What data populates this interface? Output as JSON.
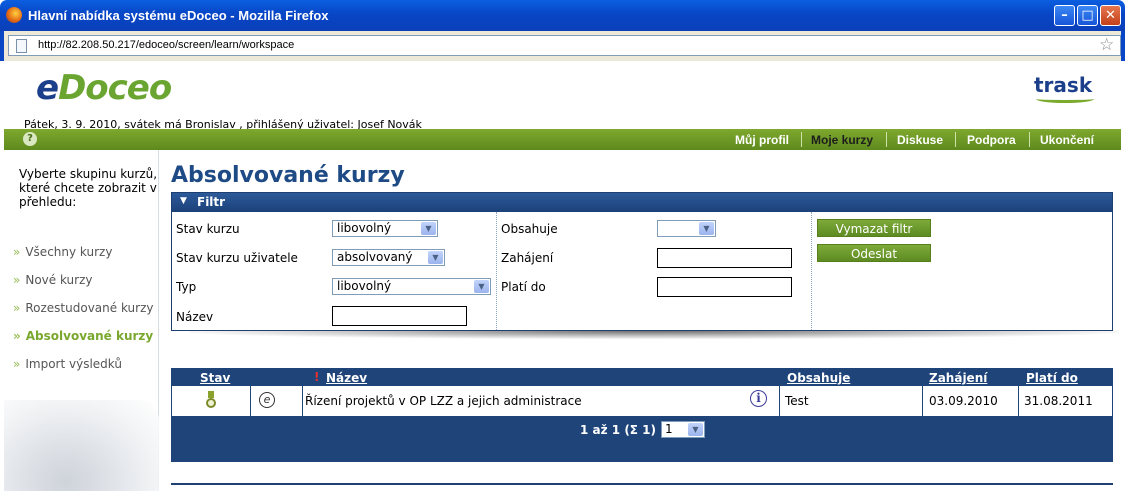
{
  "window": {
    "title": "Hlavní nabídka systému eDoceo - Mozilla Firefox",
    "min_label": "–",
    "max_label": "□",
    "close_label": "✕"
  },
  "address": {
    "url": "http://82.208.50.217/edoceo/screen/learn/workspace",
    "star": "☆"
  },
  "header": {
    "logo_e": "e",
    "logo_rest": "Doceo",
    "partner_logo": "trask",
    "dateline": "Pátek, 3. 9. 2010, svátek má Bronislav , přihlášený uživatel: Josef Novák"
  },
  "nav": {
    "help_icon": "?",
    "items": [
      "Můj profil",
      "Moje kurzy",
      "Diskuse",
      "Podpora",
      "Ukončení"
    ],
    "active": "Moje kurzy"
  },
  "sidebar": {
    "intro": "Vyberte skupinu kurzů, které chcete zobrazit v přehledu:",
    "bullet": "»",
    "items": [
      "Všechny kurzy",
      "Nové kurzy",
      "Rozestudované kurzy",
      "Absolvované kurzy",
      "Import výsledků"
    ],
    "active": "Absolvované kurzy"
  },
  "main": {
    "title": "Absolvované kurzy"
  },
  "filter": {
    "header": "Filtr",
    "toggle_icon": "▼",
    "labels": {
      "stav_kurzu": "Stav kurzu",
      "stav_kurzu_uzivatele": "Stav kurzu uživatele",
      "typ": "Typ",
      "nazev": "Název",
      "obsahuje": "Obsahuje",
      "zahajeni": "Zahájení",
      "plati_do": "Platí do"
    },
    "values": {
      "stav_kurzu": "libovolný",
      "stav_kurzu_uzivatele": "absolvovaný",
      "typ": "libovolný",
      "nazev": "",
      "obsahuje": "",
      "zahajeni": "",
      "plati_do": ""
    },
    "buttons": {
      "clear": "Vymazat filtr",
      "submit": "Odeslat"
    },
    "dropdown_arrow": "▼"
  },
  "results": {
    "columns": [
      "Stav",
      "Název",
      "Obsahuje",
      "Zahájení",
      "Platí do"
    ],
    "sort_marker": "!",
    "rows": [
      {
        "status_icon": "medal-icon",
        "type_icon": "e",
        "name": "Řízení projektů v OP LZZ a jejich administrace",
        "info_icon": "i",
        "contains": "Test",
        "start": "03.09.2010",
        "valid_to": "31.08.2011"
      }
    ],
    "pager_text": "1 až 1 (Σ 1)",
    "page_selected": "1"
  },
  "colors": {
    "brand_green": "#6aa531",
    "brand_blue": "#1e4479",
    "title_blue": "#1e4a85"
  }
}
